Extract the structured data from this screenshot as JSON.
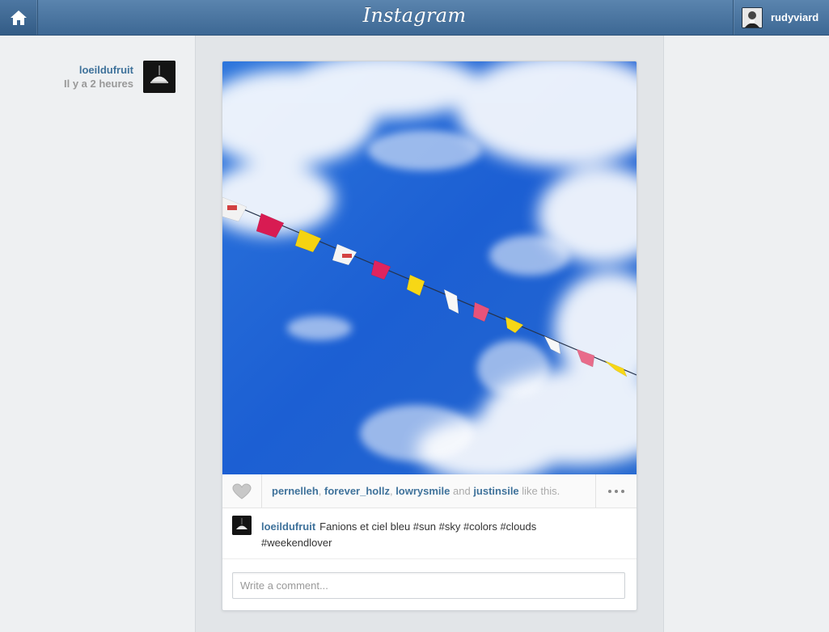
{
  "topbar": {
    "logo": "Instagram",
    "home_icon": "home-icon",
    "current_user": "rudyviard"
  },
  "post": {
    "author": "loeildufruit",
    "time_ago": "Il y a 2 heures",
    "likes": {
      "users": [
        "pernelleh",
        "forever_hollz",
        "lowrysmile",
        "justinsile"
      ],
      "sep1": ", ",
      "sep2": ", ",
      "and_word": " and ",
      "suffix": " like this."
    },
    "caption": {
      "author": "loeildufruit",
      "text": "Fanions et ciel bleu #sun #sky #colors #clouds #weekendlover"
    },
    "comment_placeholder": "Write a comment..."
  },
  "colors": {
    "link_blue": "#3f729b",
    "topbar": "#4a75a0",
    "sky": "#1f63d6"
  }
}
